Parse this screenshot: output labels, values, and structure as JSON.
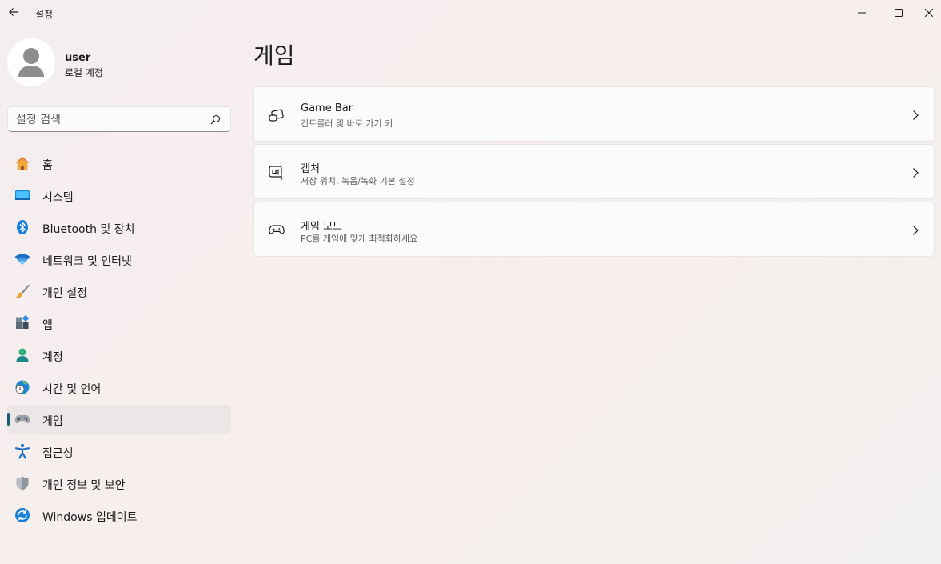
{
  "window": {
    "title": "설정"
  },
  "user": {
    "name": "user",
    "account_type": "로컬 계정"
  },
  "search": {
    "placeholder": "설정 검색"
  },
  "nav": {
    "items": [
      {
        "label": "홈",
        "icon": "home-icon"
      },
      {
        "label": "시스템",
        "icon": "system-icon"
      },
      {
        "label": "Bluetooth 및 장치",
        "icon": "bluetooth-icon"
      },
      {
        "label": "네트워크 및 인터넷",
        "icon": "wifi-icon"
      },
      {
        "label": "개인 설정",
        "icon": "brush-icon"
      },
      {
        "label": "앱",
        "icon": "apps-icon"
      },
      {
        "label": "계정",
        "icon": "account-icon"
      },
      {
        "label": "시간 및 언어",
        "icon": "globe-clock-icon"
      },
      {
        "label": "게임",
        "icon": "gamepad-icon"
      },
      {
        "label": "접근성",
        "icon": "accessibility-icon"
      },
      {
        "label": "개인 정보 및 보안",
        "icon": "shield-icon"
      },
      {
        "label": "Windows 업데이트",
        "icon": "update-icon"
      }
    ],
    "active_index": 8
  },
  "main": {
    "title": "게임",
    "cards": [
      {
        "title": "Game Bar",
        "subtitle": "컨트롤러 및 바로 가기 키",
        "icon": "game-bar-icon"
      },
      {
        "title": "캡처",
        "subtitle": "저장 위치, 녹음/녹화 기본 설정",
        "icon": "capture-icon"
      },
      {
        "title": "게임 모드",
        "subtitle": "PC를 게임에 맞게 최적화하세요",
        "icon": "game-mode-icon"
      }
    ]
  },
  "colors": {
    "accent": "#1f5c73",
    "active_item_bg": "#ece7e7"
  }
}
